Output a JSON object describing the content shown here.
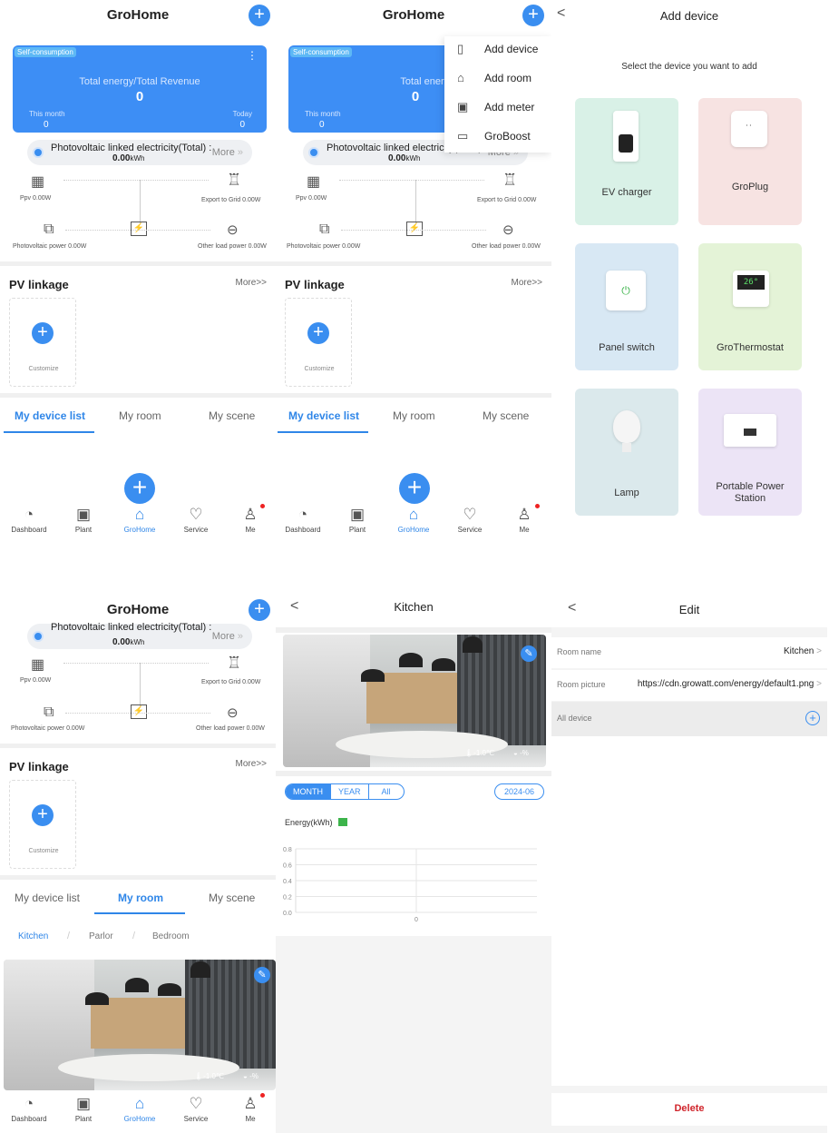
{
  "app_title": "GroHome",
  "dashboard": {
    "tag": "Self-consumption",
    "card_title": "Total energy/Total Revenue",
    "card_value": "0",
    "this_month_label": "This month",
    "this_month_value": "0",
    "today_label": "Today",
    "today_value": "0",
    "pv_title": "Photovoltaic linked electricity(Total)",
    "pv_colon": ":",
    "pv_value": "0.00",
    "pv_unit": "kWh",
    "more_label": "More",
    "more_arrow": "»",
    "ppv_label": "Ppv 0.00W",
    "export_label": "Export to Grid 0.00W",
    "pv_power_label": "Photovoltaic power 0.00W",
    "other_load_label": "Other load power 0.00W"
  },
  "pv_linkage": {
    "title": "PV linkage",
    "more": "More>>",
    "customize": "Customize"
  },
  "tabs": [
    "My device list",
    "My room",
    "My scene"
  ],
  "bottom_nav": [
    "Dashboard",
    "Plant",
    "GroHome",
    "Service",
    "Me"
  ],
  "dropdown": [
    "Add device",
    "Add room",
    "Add meter",
    "GroBoost"
  ],
  "add_device": {
    "back": "<",
    "title": "Add device",
    "subtitle": "Select the device you want to add",
    "devices": [
      "EV charger",
      "GroPlug",
      "Panel switch",
      "GroThermostat",
      "Lamp",
      "Portable Power\nStation"
    ],
    "thermo_reading": "26°"
  },
  "room_filter": {
    "kitchen": "Kitchen",
    "slash1": "/",
    "parlor": "Parlor",
    "slash2": "/",
    "bedroom": "Bedroom"
  },
  "room_card": {
    "temp": "-1.0℃",
    "humidity": "-%"
  },
  "kitchen": {
    "back": "<",
    "title": "Kitchen",
    "tabs": [
      "MONTH",
      "YEAR",
      "All"
    ],
    "date": "2024-06",
    "legend": "Energy(kWh)",
    "temp": "-1.0℃",
    "humidity": "-%"
  },
  "chart_data": {
    "type": "bar",
    "categories": [
      "0"
    ],
    "series": [
      {
        "name": "Energy(kWh)",
        "values": [
          0
        ]
      }
    ],
    "ylim": [
      0,
      0.8
    ],
    "y_ticks": [
      "0.8",
      "0.6",
      "0.4",
      "0.2",
      "0.0"
    ],
    "color": "#3cb44b"
  },
  "edit": {
    "back": "<",
    "title": "Edit",
    "room_name_label": "Room name",
    "room_name_value": "Kitchen",
    "room_picture_label": "Room picture",
    "room_picture_value": "https://cdn.growatt.com/energy/default1.png",
    "all_device_label": "All device",
    "delete_label": "Delete",
    "row_arrow": ">"
  }
}
